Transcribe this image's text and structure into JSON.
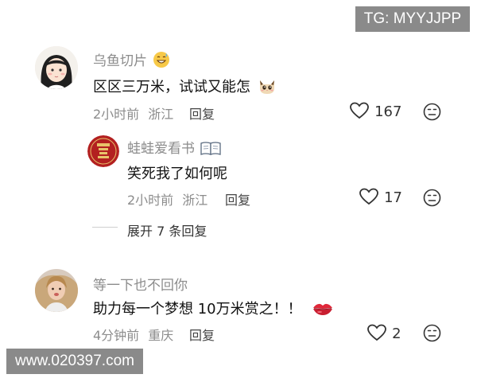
{
  "watermarks": {
    "tg": "TG: MYYJJPP",
    "url": "www.020397.com"
  },
  "comments": [
    {
      "username": "乌鱼切片",
      "text": "区区三万米，试试又能怎",
      "time": "2小时前",
      "location": "浙江",
      "reply_label": "回复",
      "likes": "167"
    },
    {
      "username": "等一下也不回你",
      "text": "助力每一个梦想 10万米赏之！！",
      "time": "4分钟前",
      "location": "重庆",
      "reply_label": "回复",
      "likes": "2"
    }
  ],
  "reply": {
    "username": "蛙蛙爱看书",
    "text": "笑死我了如何呢",
    "time": "2小时前",
    "location": "浙江",
    "reply_label": "回复",
    "likes": "17"
  },
  "expand_label": "展开 7 条回复",
  "colors": {
    "muted": "#8c8c8c",
    "text": "#111111",
    "watermark_bg": "#8a8a8a"
  },
  "icons": [
    "heart-icon",
    "dislike-face-icon",
    "grinning-sweat-emoji",
    "cat-emoji",
    "book-emoji",
    "lips-emoji"
  ]
}
